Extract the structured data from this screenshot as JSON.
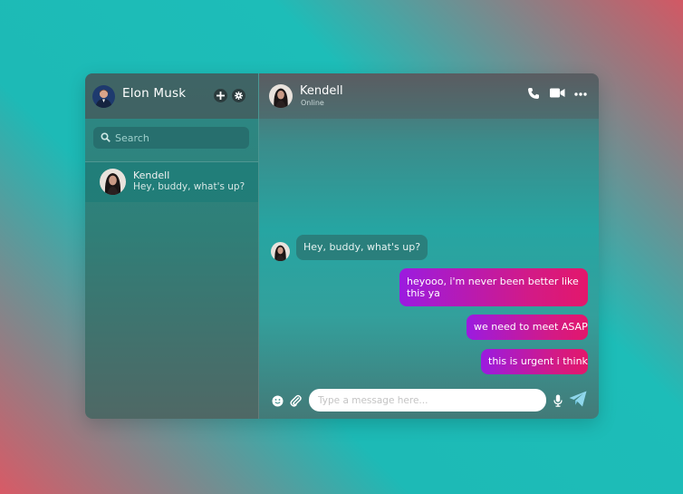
{
  "user": {
    "name": "Elon Musk"
  },
  "sidebar": {
    "search_placeholder": "Search",
    "conversations": [
      {
        "name": "Kendell",
        "preview": "Hey, buddy, what's up? ..."
      }
    ]
  },
  "chat": {
    "peer_name": "Kendell",
    "peer_status": "Online",
    "messages": [
      {
        "direction": "incoming",
        "text": "Hey, buddy, what's up?"
      },
      {
        "direction": "outgoing",
        "text": "heyooo, i'm never been better like this ya"
      },
      {
        "direction": "outgoing",
        "text": "we need to meet ASAP"
      },
      {
        "direction": "outgoing",
        "text": "this is urgent i think"
      }
    ],
    "input_placeholder": "Type a message here..."
  },
  "icons": {
    "add": "plus-icon",
    "settings": "gear-icon",
    "search": "search-icon",
    "call": "phone-icon",
    "video": "video-icon",
    "more": "more-icon",
    "emoji": "smile-icon",
    "attach": "paperclip-icon",
    "mic": "microphone-icon",
    "send": "send-icon"
  },
  "colors": {
    "outgoing_bubble_start": "#9b1be0",
    "outgoing_bubble_end": "#e3176b",
    "incoming_bubble": "#2a7f7c"
  }
}
